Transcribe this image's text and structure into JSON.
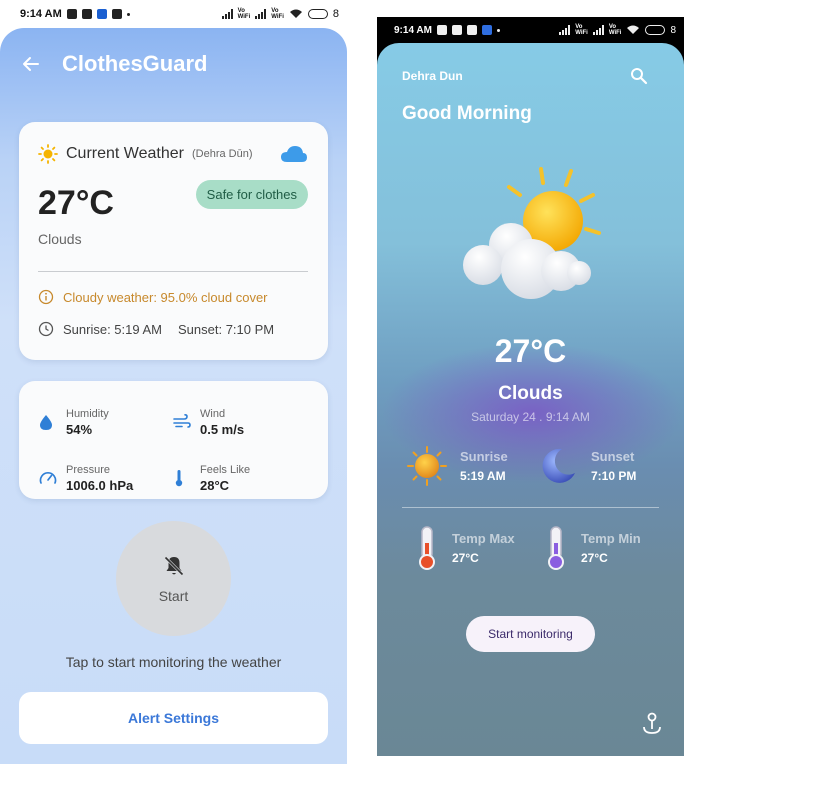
{
  "left": {
    "status": {
      "time": "9:14 AM",
      "battery": "8"
    },
    "app_title": "ClothesGuard",
    "weather_card": {
      "title": "Current Weather",
      "location": "(Dehra Dūn)",
      "temperature": "27°C",
      "condition": "Clouds",
      "badge": "Safe for clothes",
      "alert": "Cloudy weather: 95.0% cloud cover",
      "sunrise": "Sunrise: 5:19 AM",
      "sunset": "Sunset: 7:10 PM"
    },
    "details": {
      "humidity": {
        "label": "Humidity",
        "value": "54%"
      },
      "wind": {
        "label": "Wind",
        "value": "0.5 m/s"
      },
      "pressure": {
        "label": "Pressure",
        "value": "1006.0 hPa"
      },
      "feels_like": {
        "label": "Feels Like",
        "value": "28°C"
      }
    },
    "start_label": "Start",
    "hint": "Tap to start monitoring the weather",
    "alert_settings": "Alert Settings",
    "colors": {
      "accent": "#3b78d8",
      "badge_bg": "#a8ddc7",
      "warning": "#c7892c"
    }
  },
  "right": {
    "status": {
      "time": "9:14 AM",
      "battery": "8"
    },
    "city": "Dehra Dun",
    "greeting": "Good Morning",
    "temperature": "27°C",
    "condition": "Clouds",
    "date": "Saturday 24 . 9:14 AM",
    "sunrise": {
      "label": "Sunrise",
      "value": "5:19 AM"
    },
    "sunset": {
      "label": "Sunset",
      "value": "7:10 PM"
    },
    "temp_max": {
      "label": "Temp Max",
      "value": "27°C"
    },
    "temp_min": {
      "label": "Temp Min",
      "value": "27°C"
    },
    "monitor_button": "Start monitoring"
  }
}
